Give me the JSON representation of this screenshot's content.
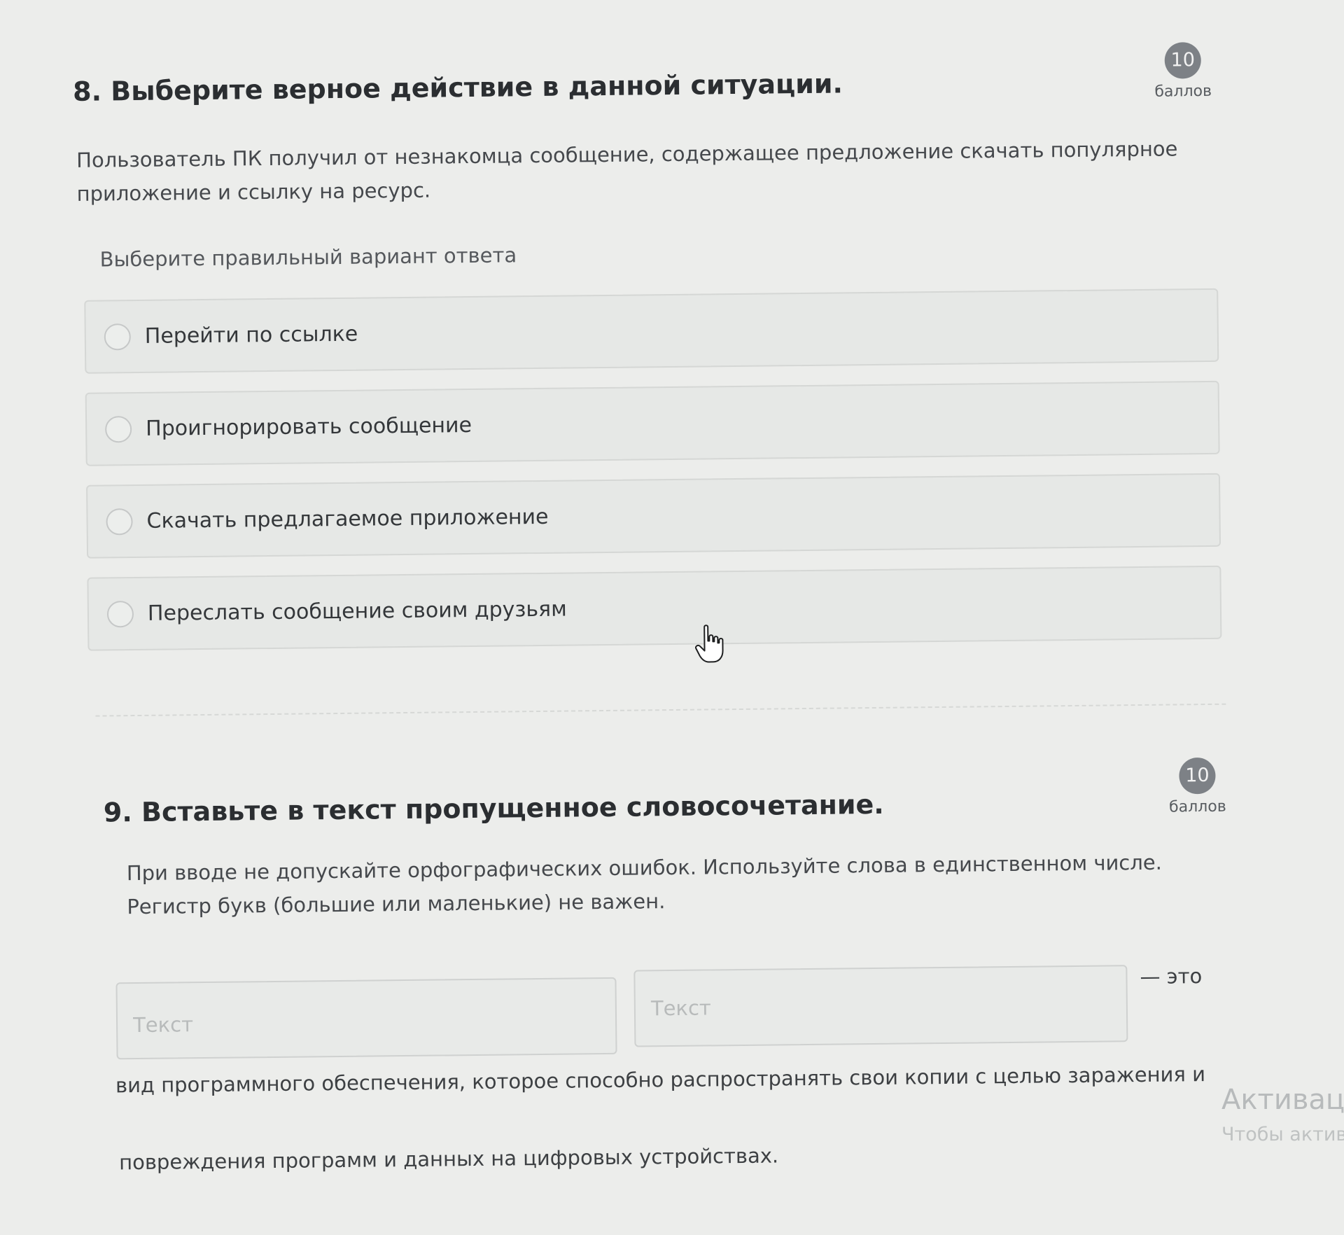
{
  "question_8": {
    "title": "8. Выберите верное действие в данной ситуации.",
    "points_value": "10",
    "points_label": "баллов",
    "text": "Пользователь ПК получил от незнакомца сообщение, содержащее предложение скачать популярное приложение и ссылку на ресурс.",
    "instruction": "Выберите правильный вариант ответа",
    "options": [
      {
        "label": "Перейти по ссылке"
      },
      {
        "label": "Проигнорировать сообщение"
      },
      {
        "label": "Скачать предлагаемое приложение"
      },
      {
        "label": "Переслать сообщение своим друзьям"
      }
    ]
  },
  "question_9": {
    "title": "9. Вставьте в текст пропущенное словосочетание.",
    "points_value": "10",
    "points_label": "баллов",
    "text": "При вводе не допускайте орфографических ошибок. Используйте слова в единственном числе. Регистр букв (большие или маленькие) не важен.",
    "blank_1_placeholder": "Текст",
    "blank_2_placeholder": "Текст",
    "after_blanks": "— это",
    "sentence_line_1": "вид программного обеспечения, которое способно распространять свои копии с целью заражения и",
    "sentence_line_2": "повреждения программ и данных на цифровых устройствах."
  },
  "windows_watermark": {
    "line_1": "Активаци",
    "line_2": "Чтобы актив"
  },
  "cursor_icon": "hand-pointer-icon"
}
